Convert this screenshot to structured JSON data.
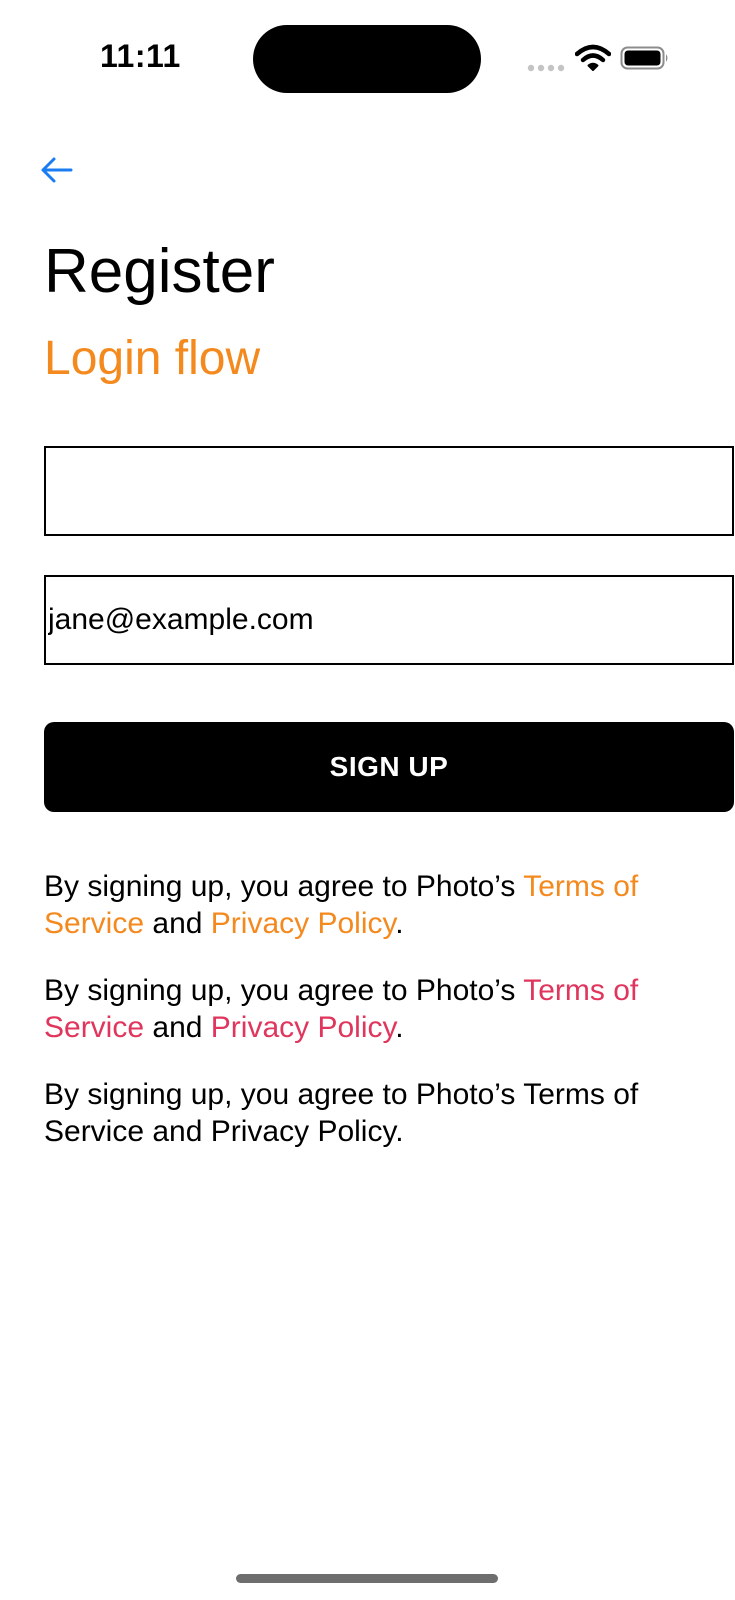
{
  "status_bar": {
    "time": "11:11",
    "icons": [
      "signal-dots-icon",
      "wifi-icon",
      "battery-icon"
    ]
  },
  "nav": {
    "back_icon": "arrow-left-icon"
  },
  "header": {
    "title": "Register",
    "subtitle": "Login flow"
  },
  "form": {
    "name_value": "",
    "email_value": "jane@example.com",
    "signup_label": "SIGN UP"
  },
  "legal": [
    {
      "prefix": "By signing up, you agree to Photo’s ",
      "terms": "Terms of Service",
      "middle": " and ",
      "privacy": "Privacy Policy",
      "suffix": ".",
      "link_color": "#F4891E"
    },
    {
      "prefix": "By signing up, you agree to Photo’s ",
      "terms": "Terms of Service",
      "middle": " and ",
      "privacy": "Privacy Policy",
      "suffix": ".",
      "link_color": "#E0355C"
    },
    {
      "text": "By signing up, you agree to Photo’s Terms of Service and Privacy Policy."
    }
  ],
  "colors": {
    "accent_orange": "#F4891E",
    "accent_pink": "#E0355C",
    "back_arrow": "#1A7CF2"
  }
}
